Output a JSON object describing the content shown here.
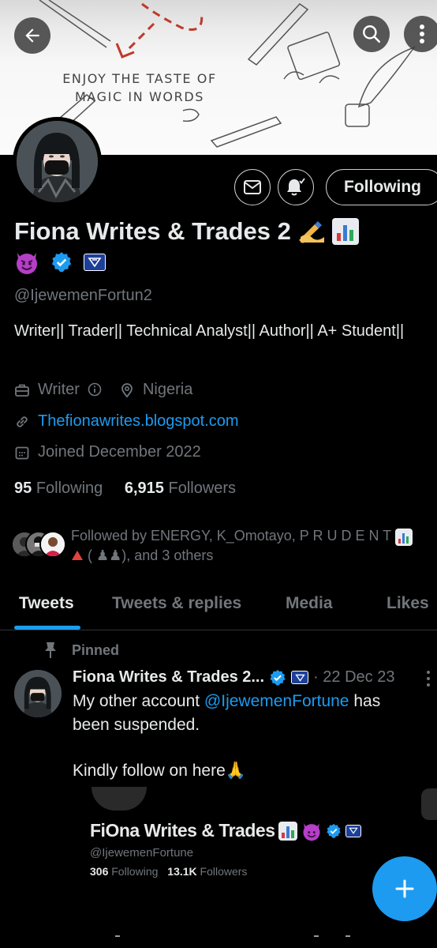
{
  "banner": {
    "tagline": "ENJOY THE TASTE OF MAGIC IN WORDS"
  },
  "header": {
    "back_icon": "arrow-left-icon",
    "search_icon": "search-icon",
    "more_icon": "more-vertical-icon"
  },
  "actions": {
    "message_icon": "mail-icon",
    "notifications_icon": "bell-check-icon",
    "follow_label": "Following"
  },
  "profile": {
    "display_name": "Fiona Writes & Trades 2",
    "handle": "@IjewemenFortun2",
    "bio": "Writer|| Trader|| Technical Analyst|| Author|| A+ Student||",
    "category": "Writer",
    "location": "Nigeria",
    "website": "Thefionawrites.blogspot.com",
    "joined": "Joined December 2022",
    "following_count": "95",
    "following_label": "Following",
    "followers_count": "6,915",
    "followers_label": "Followers",
    "followed_by": "Followed by ENERGY, K_Omotayo, P R U D E N T",
    "followed_by_tail": "( ♟♟), and 3 others"
  },
  "tabs": [
    {
      "label": "Tweets",
      "active": true
    },
    {
      "label": "Tweets & replies",
      "active": false
    },
    {
      "label": "Media",
      "active": false
    },
    {
      "label": "Likes",
      "active": false
    }
  ],
  "tweet": {
    "pinned_label": "Pinned",
    "author_name": "Fiona Writes & Trades 2...",
    "date": "· 22 Dec 23",
    "text_before_mention": "My other account ",
    "mention": "@IjewemenFortune",
    "text_after_mention": " has been suspended.",
    "text_line2": "Kindly follow on here🙏",
    "embedded_card": {
      "name": "FiOna Writes & Trades",
      "handle": "@IjewemenFortune",
      "following_count": "306",
      "following_label": "Following",
      "followers_count": "13.1K",
      "followers_label": "Followers"
    }
  },
  "fab": {
    "icon": "plus-icon"
  },
  "colors": {
    "background": "#000000",
    "accent": "#1d9bf0",
    "text_primary": "#e7e9ea",
    "text_secondary": "#71767b"
  }
}
